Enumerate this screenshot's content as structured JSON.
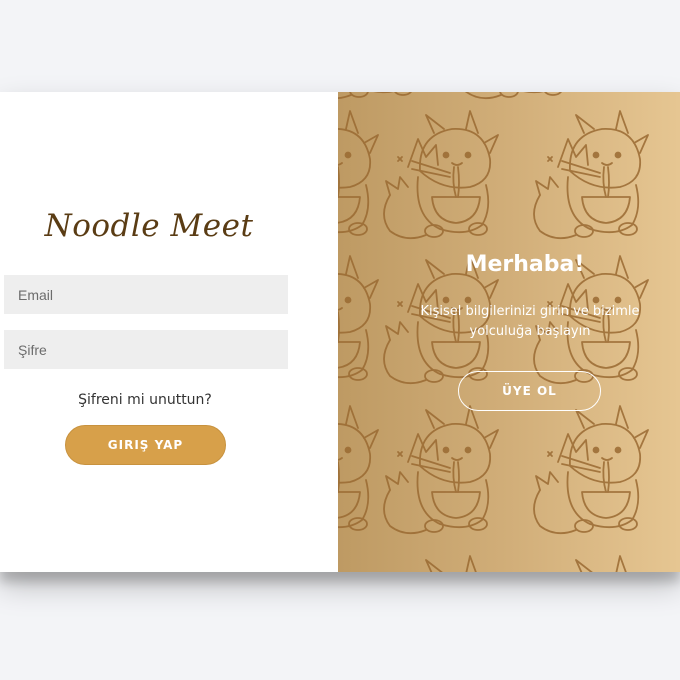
{
  "sign_in": {
    "logo": "Noodle Meet",
    "email_placeholder": "Email",
    "password_placeholder": "Şifre",
    "forgot_link": "Şifreni mi unuttun?",
    "login_button": "GIRIŞ YAP"
  },
  "overlay": {
    "title": "Merhaba!",
    "text": "Kişisel bilgilerinizi girin ve bizimle yolculuğa başlayın",
    "signup_button": "ÜYE OL",
    "pattern_icon": "dragon-eating-noodles-icon"
  },
  "colors": {
    "accent": "#d7a04a",
    "logo": "#5a3c14",
    "input_bg": "#eeeeee",
    "overlay_gradient_start": "#be9a63",
    "overlay_gradient_end": "#e6c692",
    "pattern_stroke": "#9a6a32"
  }
}
